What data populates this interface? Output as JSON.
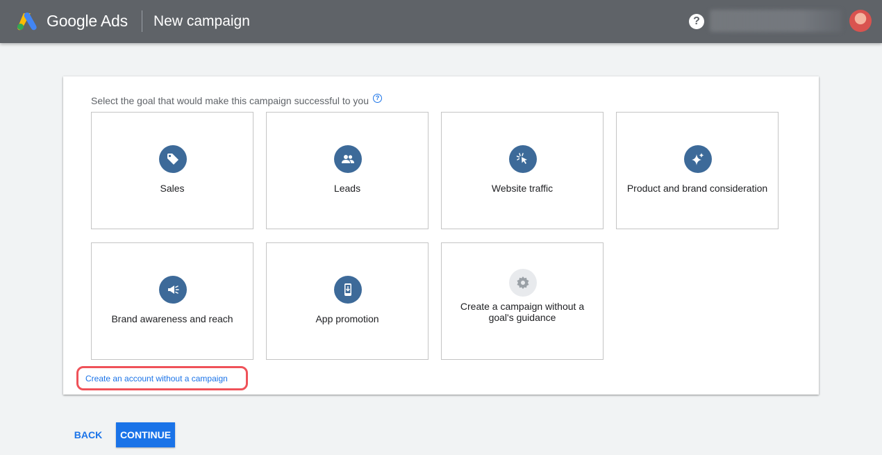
{
  "header": {
    "brand": "Google Ads",
    "title": "New campaign",
    "help_label": "?"
  },
  "goal_prompt": "Select the goal that would make this campaign successful to you",
  "prompt_help_label": "?",
  "goals": [
    {
      "label": "Sales",
      "icon": "tag-icon"
    },
    {
      "label": "Leads",
      "icon": "people-icon"
    },
    {
      "label": "Website traffic",
      "icon": "cursor-click-icon"
    },
    {
      "label": "Product and brand consideration",
      "icon": "sparkle-icon"
    },
    {
      "label": "Brand awareness and reach",
      "icon": "megaphone-icon"
    },
    {
      "label": "App promotion",
      "icon": "phone-download-icon"
    },
    {
      "label": "Create a campaign without a goal's guidance",
      "icon": "gear-icon"
    }
  ],
  "create_account_link": "Create an account without a campaign",
  "buttons": {
    "back": "BACK",
    "continue": "CONTINUE"
  },
  "colors": {
    "header_bg": "#5f6368",
    "icon_bg": "#3d6a99",
    "accent": "#1a73e8",
    "highlight": "#ef5259"
  }
}
